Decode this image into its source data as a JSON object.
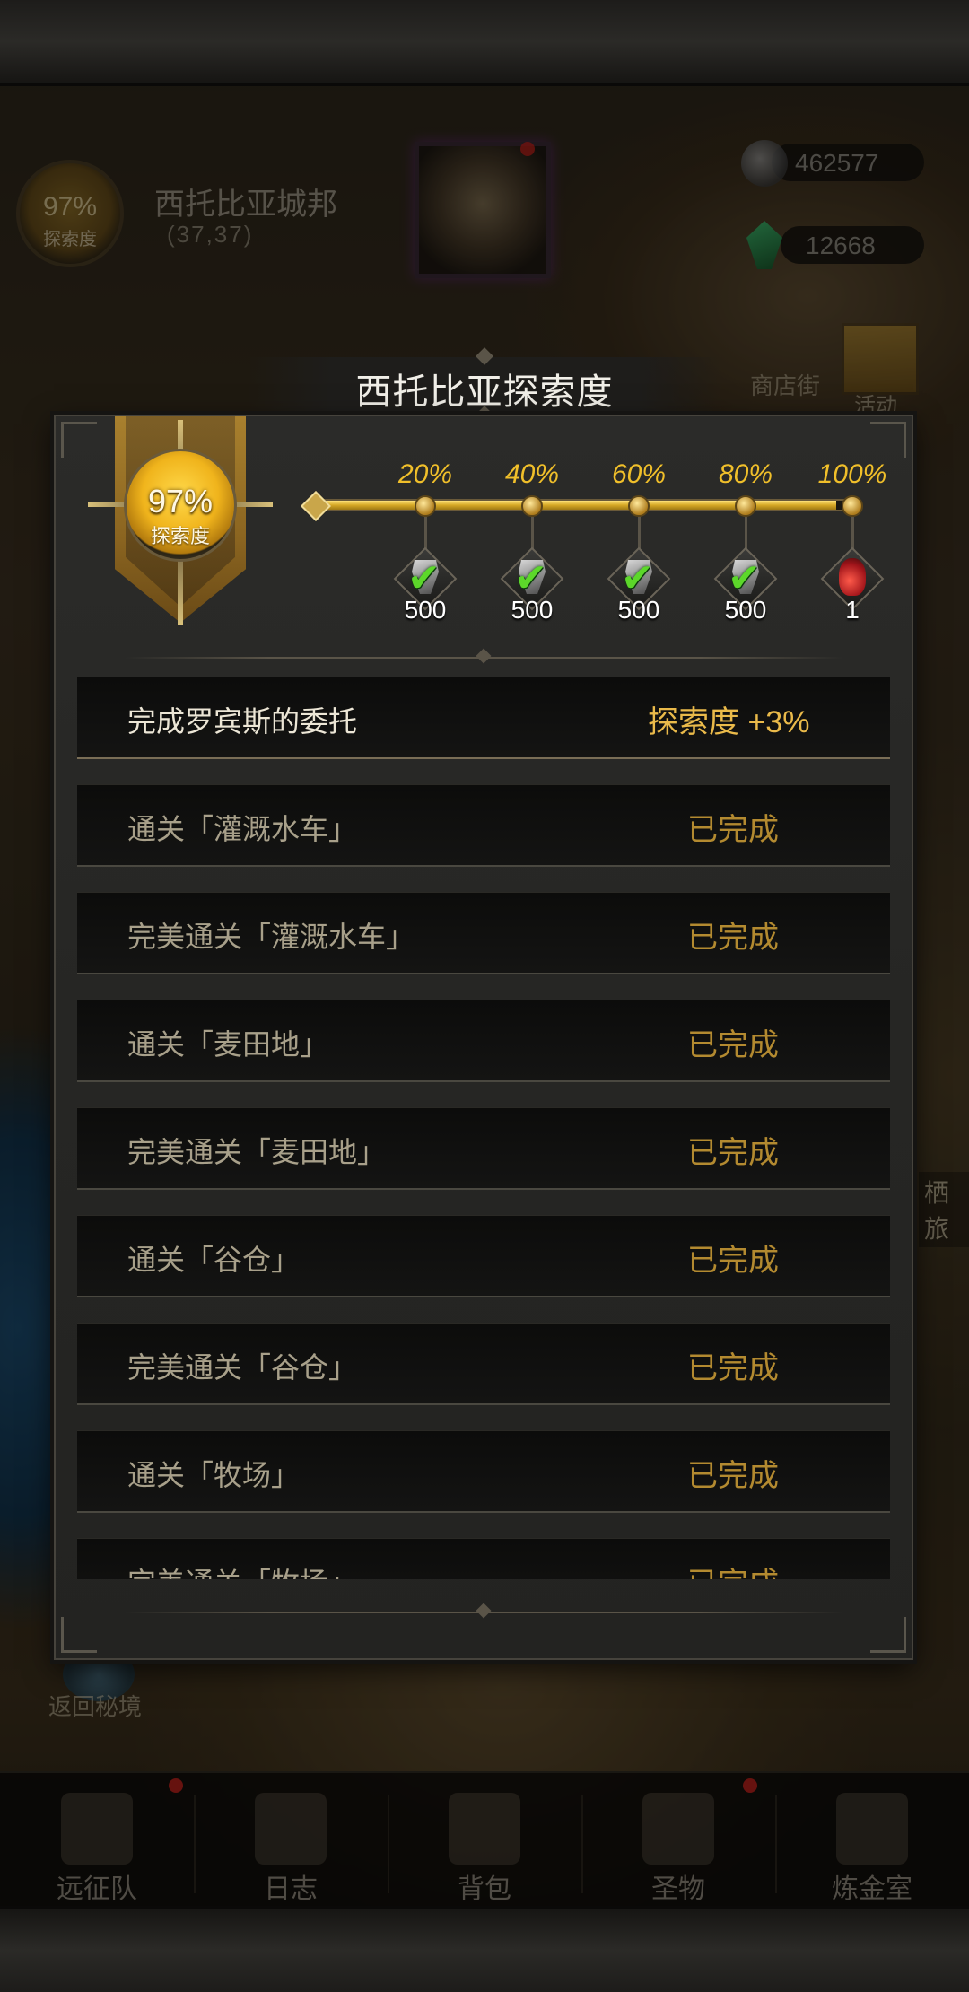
{
  "hud": {
    "explore_pct": "97%",
    "explore_label": "探索度",
    "city_name": "西托比亚城邦",
    "city_coord": "(37,37)",
    "silver": "462577",
    "gems": "12668",
    "shop_label": "商店街",
    "activity_label": "活动",
    "side_label": "栖旅",
    "return_label": "返回秘境"
  },
  "dialog": {
    "title": "西托比亚探索度",
    "explore_pct": "97%",
    "explore_label": "探索度",
    "progress": {
      "value": 0.97
    },
    "milestones": [
      {
        "pct": "20%",
        "reward": "iron-ore",
        "qty": "500",
        "claimed": true
      },
      {
        "pct": "40%",
        "reward": "iron-ore",
        "qty": "500",
        "claimed": true
      },
      {
        "pct": "60%",
        "reward": "iron-ore",
        "qty": "500",
        "claimed": true
      },
      {
        "pct": "80%",
        "reward": "iron-ore",
        "qty": "500",
        "claimed": true
      },
      {
        "pct": "100%",
        "reward": "red-potion",
        "qty": "1",
        "claimed": false
      }
    ],
    "tasks": [
      {
        "name": "完成罗宾斯的委托",
        "status": "探索度 +3%",
        "highlight": true
      },
      {
        "name": "通关「灌溉水车」",
        "status": "已完成"
      },
      {
        "name": "完美通关「灌溉水车」",
        "status": "已完成"
      },
      {
        "name": "通关「麦田地」",
        "status": "已完成"
      },
      {
        "name": "完美通关「麦田地」",
        "status": "已完成"
      },
      {
        "name": "通关「谷仓」",
        "status": "已完成"
      },
      {
        "name": "完美通关「谷仓」",
        "status": "已完成"
      },
      {
        "name": "通关「牧场」",
        "status": "已完成"
      },
      {
        "name": "完美通关「牧场」",
        "status": "已完成"
      }
    ]
  },
  "nav": {
    "items": [
      {
        "label": "远征队",
        "icon": "helmet-icon",
        "badge": true
      },
      {
        "label": "日志",
        "icon": "scroll-icon",
        "badge": false
      },
      {
        "label": "背包",
        "icon": "bag-icon",
        "badge": false
      },
      {
        "label": "圣物",
        "icon": "chalice-icon",
        "badge": true
      },
      {
        "label": "炼金室",
        "icon": "alchemy-icon",
        "badge": false
      }
    ]
  },
  "colors": {
    "gold": "#f0bf2a",
    "completed": "#b38a30",
    "check": "#5cd82a"
  }
}
